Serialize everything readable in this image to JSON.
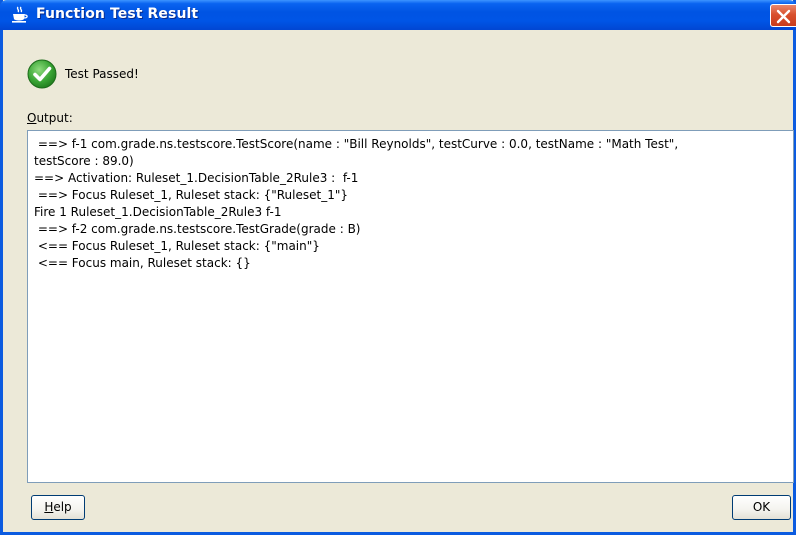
{
  "window": {
    "title": "Function Test Result",
    "title_icon": "java-cup-icon",
    "close_icon": "close-icon"
  },
  "status": {
    "icon": "check-circle-icon",
    "color": "#3aa535",
    "text": "Test Passed!"
  },
  "output": {
    "label_mnemonic": "O",
    "label_rest": "utput:",
    "lines": [
      " ==> f-1 com.grade.ns.testscore.TestScore(name : \"Bill Reynolds\", testCurve : 0.0, testName : \"Math Test\",",
      "testScore : 89.0)",
      "==> Activation: Ruleset_1.DecisionTable_2Rule3 :  f-1",
      " ==> Focus Ruleset_1, Ruleset stack: {\"Ruleset_1\"}",
      "Fire 1 Ruleset_1.DecisionTable_2Rule3 f-1",
      " ==> f-2 com.grade.ns.testscore.TestGrade(grade : B)",
      " <== Focus Ruleset_1, Ruleset stack: {\"main\"}",
      " <== Focus main, Ruleset stack: {}"
    ]
  },
  "buttons": {
    "help_mnemonic": "H",
    "help_rest": "elp",
    "ok_label": "OK"
  },
  "colors": {
    "titlebar": "#0054e3",
    "close_button": "#d9502d",
    "dialog_background": "#ece9d8",
    "output_border": "#7f9db9"
  }
}
